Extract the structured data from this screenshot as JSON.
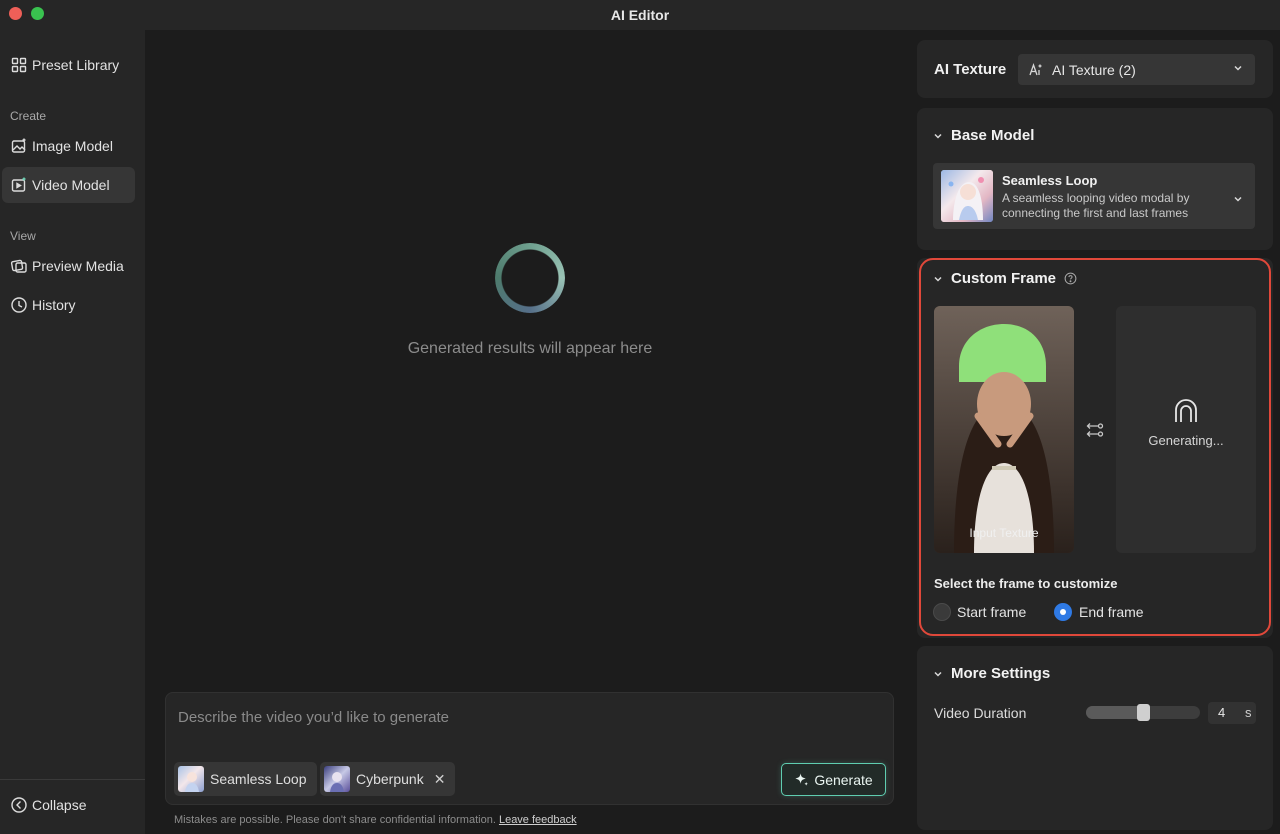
{
  "window": {
    "title": "AI Editor"
  },
  "sidebar": {
    "preset_library": "Preset Library",
    "create_section": "Create",
    "image_model": "Image Model",
    "video_model": "Video Model",
    "view_section": "View",
    "preview_media": "Preview Media",
    "history": "History",
    "collapse": "Collapse",
    "active_item": "Video Model"
  },
  "center": {
    "placeholder": "Generated results will appear here",
    "prompt_placeholder": "Describe the video you’d like to generate",
    "chips": [
      {
        "label": "Seamless Loop",
        "closable": false
      },
      {
        "label": "Cyberpunk",
        "closable": true,
        "close_glyph": "✕"
      }
    ],
    "generate_label": "Generate",
    "footer_note": "Mistakes are possible. Please don't share confidential information.",
    "feedback_link": "Leave feedback"
  },
  "right_panel": {
    "ai_texture_title": "AI Texture",
    "ai_texture_select": "AI Texture (2)",
    "base_model": {
      "heading": "Base Model",
      "model_name": "Seamless Loop",
      "model_desc": "A seamless looping video modal by connecting the first and last frames"
    },
    "custom_frame": {
      "heading": "Custom Frame",
      "input_label": "Input Texture",
      "generating_label": "Generating...",
      "select_prompt": "Select the frame to customize",
      "options": [
        "Start frame",
        "End frame"
      ],
      "selected": "End frame",
      "highlight_color": "#e0483a"
    },
    "more_settings": {
      "heading": "More Settings",
      "duration_label": "Video Duration",
      "duration_value": "4",
      "duration_unit": "s",
      "duration_slider_fraction": 0.5
    }
  },
  "colors": {
    "accent": "#5fcdb0",
    "radio_selected": "#2f7ae5",
    "traffic_red": "#ee5f58",
    "traffic_green": "#39c24f"
  }
}
